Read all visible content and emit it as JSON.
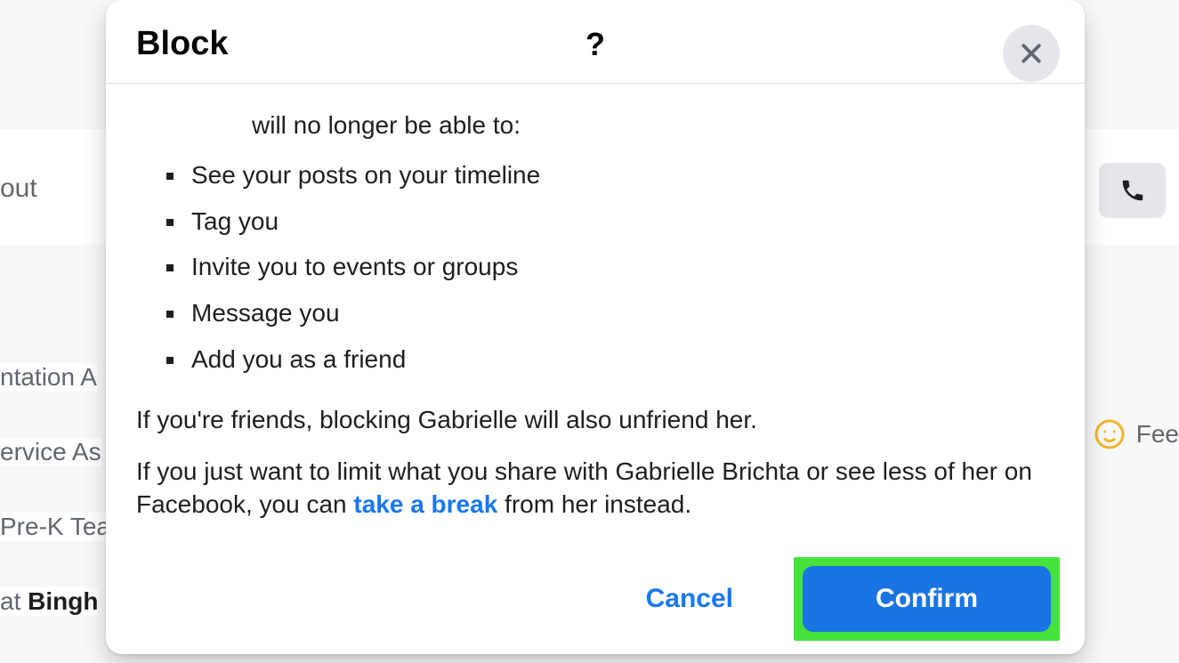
{
  "background": {
    "nav_item": "out",
    "rows": {
      "intro": "ntation A",
      "service": "ervice As",
      "prek": "Pre-K Tea",
      "bingh_prefix": "at ",
      "bingh_bold": "Bingh"
    },
    "feed_label": "Fee"
  },
  "modal": {
    "title": "Block",
    "question": "?",
    "intro_text": "will no longer be able to:",
    "bullets": [
      "See your posts on your timeline",
      "Tag you",
      "Invite you to events or groups",
      "Message you",
      "Add you as a friend"
    ],
    "unfriend_text": "If you're friends, blocking Gabrielle will also unfriend her.",
    "limit_text_prefix": "If you just want to limit what you share with Gabrielle Brichta or see less of her on Facebook, you can ",
    "limit_link": "take a break",
    "limit_text_suffix": " from her instead.",
    "cancel_label": "Cancel",
    "confirm_label": "Confirm"
  }
}
